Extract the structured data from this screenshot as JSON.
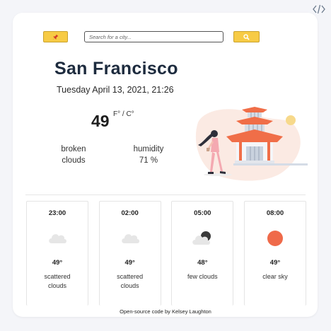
{
  "toolbar": {
    "pin_icon": "pin-icon",
    "search_placeholder": "Search for a city...",
    "search_icon": "search-icon",
    "accent_color": "#f7cb45"
  },
  "current": {
    "city": "San Francisco",
    "datetime": "Tuesday April 13, 2021, 21:26",
    "temperature": "49",
    "unit_f": "F°",
    "unit_sep": " / ",
    "unit_c": "C°",
    "description_line1": "broken",
    "description_line2": "clouds",
    "humidity_label": "humidity",
    "humidity_value": "71 %"
  },
  "forecast": [
    {
      "time": "23:00",
      "icon": "cloud-icon",
      "temp": "49°",
      "desc": "scattered clouds"
    },
    {
      "time": "02:00",
      "icon": "cloud-icon",
      "temp": "49°",
      "desc": "scattered clouds"
    },
    {
      "time": "05:00",
      "icon": "few-clouds-icon",
      "temp": "48°",
      "desc": "few clouds"
    },
    {
      "time": "08:00",
      "icon": "sun-icon",
      "temp": "49°",
      "desc": "clear sky"
    }
  ],
  "footer": {
    "link_text": "Open-source code",
    "suffix": " by Kelsey Laughton"
  },
  "icons": {
    "top_right": "code-icon"
  }
}
